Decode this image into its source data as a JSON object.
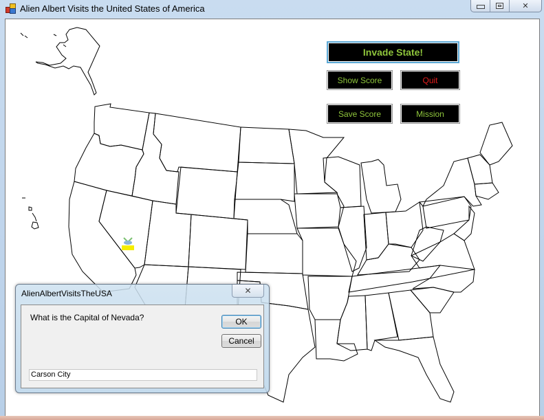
{
  "window": {
    "title": "Alien Albert Visits the United States of America",
    "app_icon": "windows-forms-app-icon",
    "controls": {
      "minimize": "minimize-icon",
      "maximize": "maximize-icon",
      "close": "✕"
    }
  },
  "toolbar": {
    "invade_label": "Invade State!",
    "show_score_label": "Show Score",
    "quit_label": "Quit",
    "save_score_label": "Save Score",
    "mission_label": "Mission"
  },
  "colors": {
    "button_bg": "#000000",
    "button_text_green": "#8fc63c",
    "button_text_red": "#e41d1d",
    "primary_border": "#5aa7d4",
    "alien_marker": "#f5ee00"
  },
  "map": {
    "subject": "United States outline map",
    "current_state": "Nevada",
    "marker": "alien-ufo-icon"
  },
  "dialog": {
    "title": "AlienAlbertVisitsTheUSA",
    "close_label": "✕",
    "prompt": "What is the Capital of Nevada?",
    "ok_label": "OK",
    "cancel_label": "Cancel",
    "answer_value": "Carson City"
  }
}
